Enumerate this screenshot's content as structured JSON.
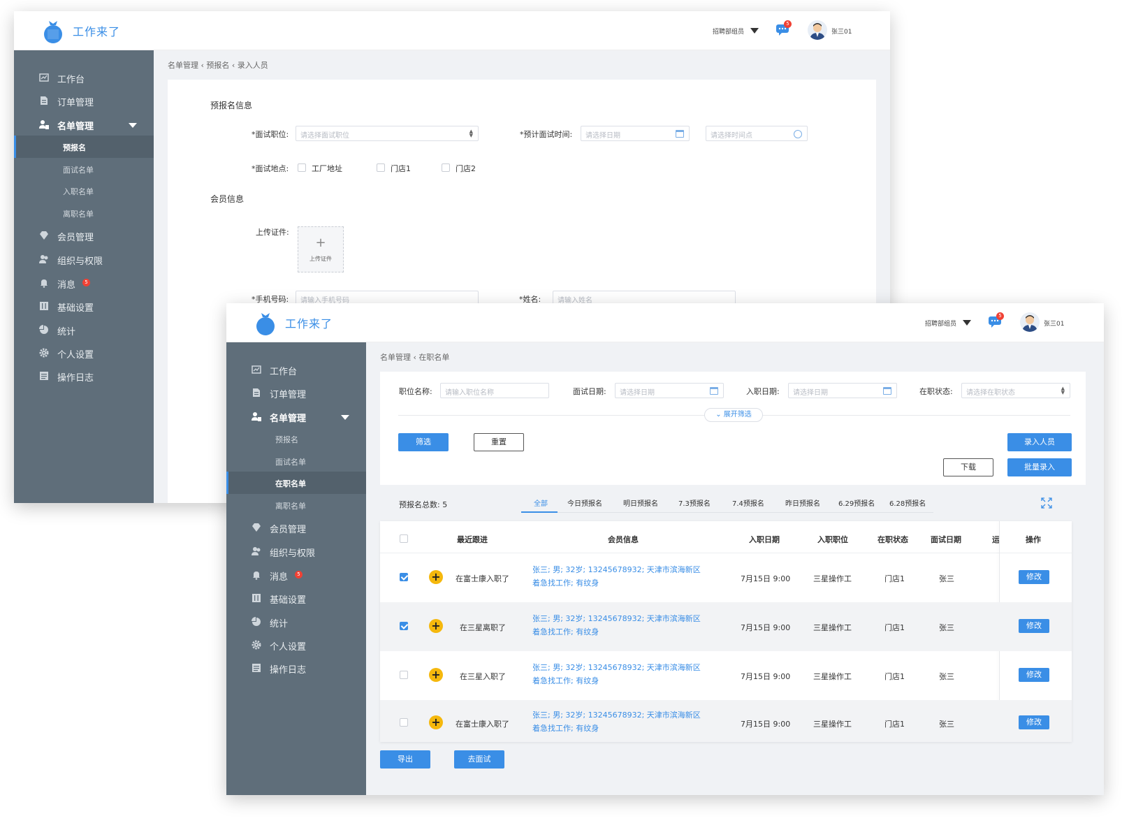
{
  "app": {
    "name": "工作来了",
    "role": "招聘部组员",
    "user": "张三01",
    "msg_count": "5"
  },
  "sidebar": {
    "items": [
      {
        "label": "工作台"
      },
      {
        "label": "订单管理"
      },
      {
        "label": "名单管理"
      },
      {
        "label": "会员管理"
      },
      {
        "label": "组织与权限"
      },
      {
        "label": "消息",
        "badge": "5"
      },
      {
        "label": "基础设置"
      },
      {
        "label": "统计"
      },
      {
        "label": "个人设置"
      },
      {
        "label": "操作日志"
      }
    ],
    "sub": [
      "预报名",
      "面试名单",
      "入职名单",
      "离职名单",
      "在职名单"
    ]
  },
  "form": {
    "breadcrumb": "名单管理 ‹ 预报名 ‹ 录入人员",
    "section_pre": "预报名信息",
    "position_label": "*面试职位:",
    "position_ph": "请选择面试职位",
    "time_label": "*预计面试时间:",
    "date_ph": "请选择日期",
    "timepoint_ph": "请选择时间点",
    "place_label": "*面试地点:",
    "places": [
      "工厂地址",
      "门店1",
      "门店2"
    ],
    "section_member": "会员信息",
    "upload_label": "上传证件:",
    "upload_btn": "上传证件",
    "phone_label": "*手机号码:",
    "phone_ph": "请输入手机号码",
    "name_label": "*姓名:",
    "name_ph": "请输入姓名"
  },
  "list": {
    "breadcrumb": "名单管理 ‹ 在职名单",
    "filters": {
      "job_label": "职位名称:",
      "job_ph": "请输入职位名称",
      "interview_label": "面试日期:",
      "entry_label": "入职日期:",
      "date_ph": "请选择日期",
      "status_label": "在职状态:",
      "status_ph": "请选择在职状态",
      "expand": "展开筛选",
      "filter_btn": "筛选",
      "reset_btn": "重置",
      "add_btn": "录入人员",
      "download_btn": "下载",
      "batch_btn": "批量录入"
    },
    "total_label": "预报名总数:",
    "total": "5",
    "tabs": [
      "全部",
      "今日预报名",
      "明日预报名",
      "7.3预报名",
      "7.4预报名",
      "昨日预报名",
      "6.29预报名",
      "6.28预报名"
    ],
    "headers": [
      "最近跟进",
      "会员信息",
      "入职日期",
      "入职职位",
      "在职状态",
      "面试日期",
      "运",
      "操作"
    ],
    "rows": [
      {
        "checked": true,
        "follow": "在富士康入职了",
        "member1": "张三; 男; 32岁; 13245678932; 天津市滨海新区",
        "member2": "着急找工作; 有纹身",
        "entry_date": "7月15日 9:00",
        "position": "三星操作工",
        "status": "门店1",
        "interview": "张三",
        "action": "修改"
      },
      {
        "checked": true,
        "follow": "在三星离职了",
        "member1": "张三; 男; 32岁; 13245678932; 天津市滨海新区",
        "member2": "着急找工作; 有纹身",
        "entry_date": "7月15日 9:00",
        "position": "三星操作工",
        "status": "门店1",
        "interview": "张三",
        "action": "修改"
      },
      {
        "checked": false,
        "follow": "在三星入职了",
        "member1": "张三; 男; 32岁; 13245678932; 天津市滨海新区",
        "member2": "着急找工作; 有纹身",
        "entry_date": "7月15日 9:00",
        "position": "三星操作工",
        "status": "门店1",
        "interview": "张三",
        "action": "修改"
      },
      {
        "checked": false,
        "follow": "在富士康入职了",
        "member1": "张三; 男; 32岁; 13245678932; 天津市滨海新区",
        "member2": "着急找工作; 有纹身",
        "entry_date": "7月15日 9:00",
        "position": "三星操作工",
        "status": "门店1",
        "interview": "张三",
        "action": "修改"
      }
    ],
    "export_btn": "导出",
    "interview_btn": "去面试"
  },
  "colors": {
    "primary": "#3a8ee6",
    "sidebar": "#5f6e7a",
    "badge": "#f04134",
    "plus": "#f5b80d"
  }
}
